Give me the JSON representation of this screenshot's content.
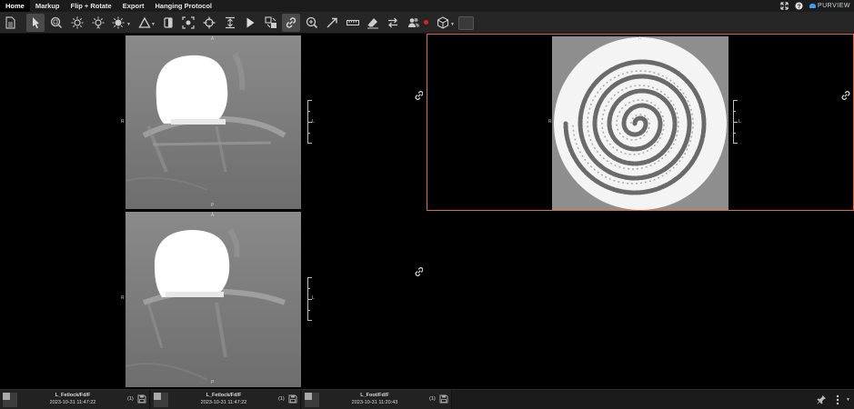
{
  "menu": {
    "items": [
      {
        "label": "Home",
        "active": true
      },
      {
        "label": "Markup",
        "active": false
      },
      {
        "label": "Flip + Rotate",
        "active": false
      },
      {
        "label": "Export",
        "active": false
      },
      {
        "label": "Hanging Protocol",
        "active": false
      }
    ],
    "brand": "PURVIEW"
  },
  "toolbar": {
    "tools": [
      "document-icon",
      "pointer-icon",
      "zoom-region-icon",
      "brightness-icon",
      "auto-contrast-icon",
      "window-level-icon",
      "measure-angle-icon",
      "invert-icon",
      "magnifier-roi-icon",
      "crosshair-icon",
      "center-icon",
      "cine-play-icon",
      "compare-icon",
      "link-icon",
      "zoom-icon",
      "arrow-annotate-icon",
      "ruler-icon",
      "eraser-icon",
      "swap-icon",
      "users-icon",
      "cube-3d-icon",
      "color-swatch-icon"
    ]
  },
  "viewports": {
    "top_left": {
      "top": "A",
      "bottom": "P",
      "left": "R",
      "right": "L"
    },
    "bottom_left": {
      "top": "A",
      "bottom": "P",
      "left": "R",
      "right": "L"
    },
    "top_right": {
      "top": "A",
      "left": "R",
      "right": "L"
    }
  },
  "series": [
    {
      "name": "L_Fetlock/Fd/F",
      "date": "2023-10-31 11:47:22",
      "count": "(1)"
    },
    {
      "name": "L_Fetlock/Fd/F",
      "date": "2023-10-31 11:47:22",
      "count": "(1)"
    },
    {
      "name": "L_Foot/Fd/F",
      "date": "2023-10-31 11:20:43",
      "count": "(1)"
    }
  ],
  "colors": {
    "accent": "#3aa0e8",
    "selected_border": "#e0684a",
    "record_dot": "#e02020"
  }
}
